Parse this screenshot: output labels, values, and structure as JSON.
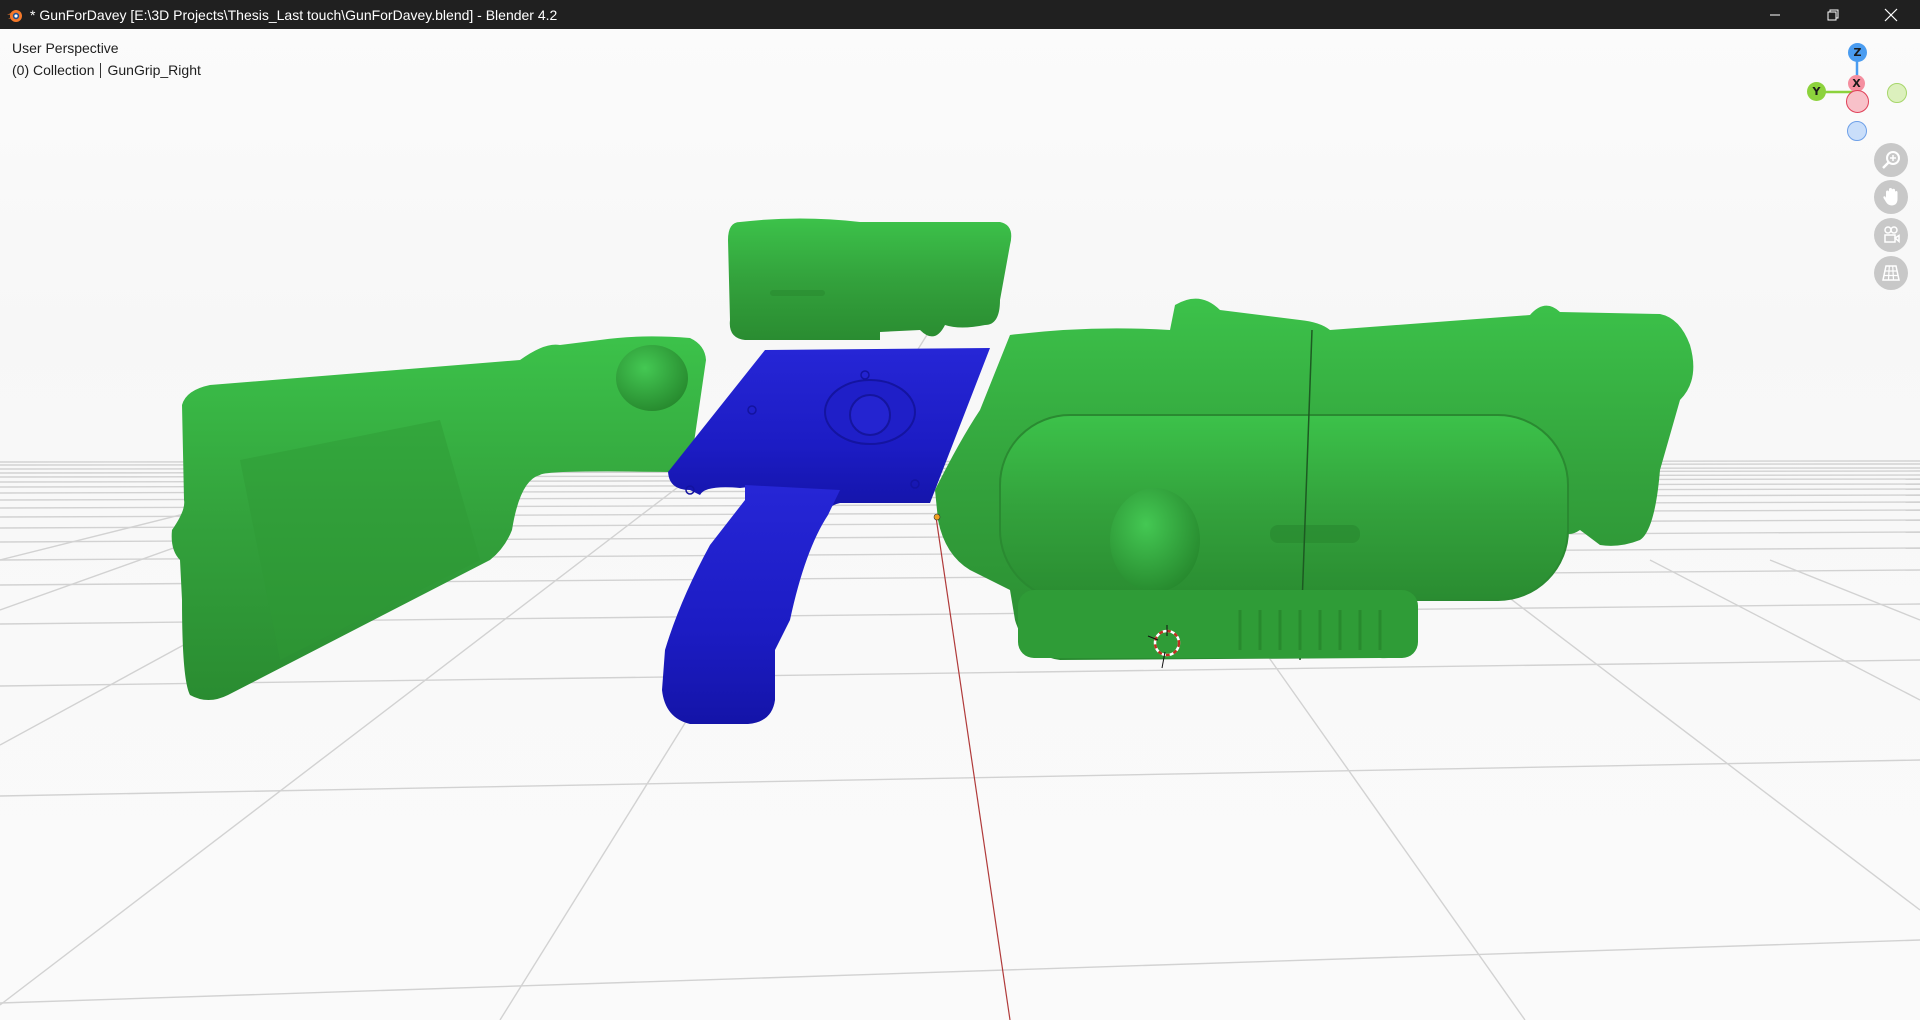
{
  "window": {
    "title": "* GunForDavey [E:\\3D Projects\\Thesis_Last touch\\GunForDavey.blend] - Blender 4.2",
    "app_icon": "blender-logo-icon",
    "controls": {
      "minimize": "minimize-icon",
      "restore": "restore-icon",
      "close": "close-icon"
    }
  },
  "viewport": {
    "view_name": "User Perspective",
    "collection_label": "(0) Collection",
    "active_object": "GunGrip_Right",
    "selected_color": "#1a1ac8",
    "object_color": "#34a33a",
    "background_color": "#fafafa",
    "x_axis_color": "#b03a3a"
  },
  "gizmo": {
    "axes": [
      {
        "label": "Z",
        "color": "#4a9cf0"
      },
      {
        "label": "Y",
        "color": "#8cd23c"
      },
      {
        "label": "X",
        "color": "#f06478"
      }
    ]
  },
  "nav_buttons": [
    {
      "name": "zoom",
      "icon": "zoom-icon"
    },
    {
      "name": "pan",
      "icon": "hand-icon"
    },
    {
      "name": "camera",
      "icon": "camera-icon"
    },
    {
      "name": "ortho",
      "icon": "grid-icon"
    }
  ]
}
